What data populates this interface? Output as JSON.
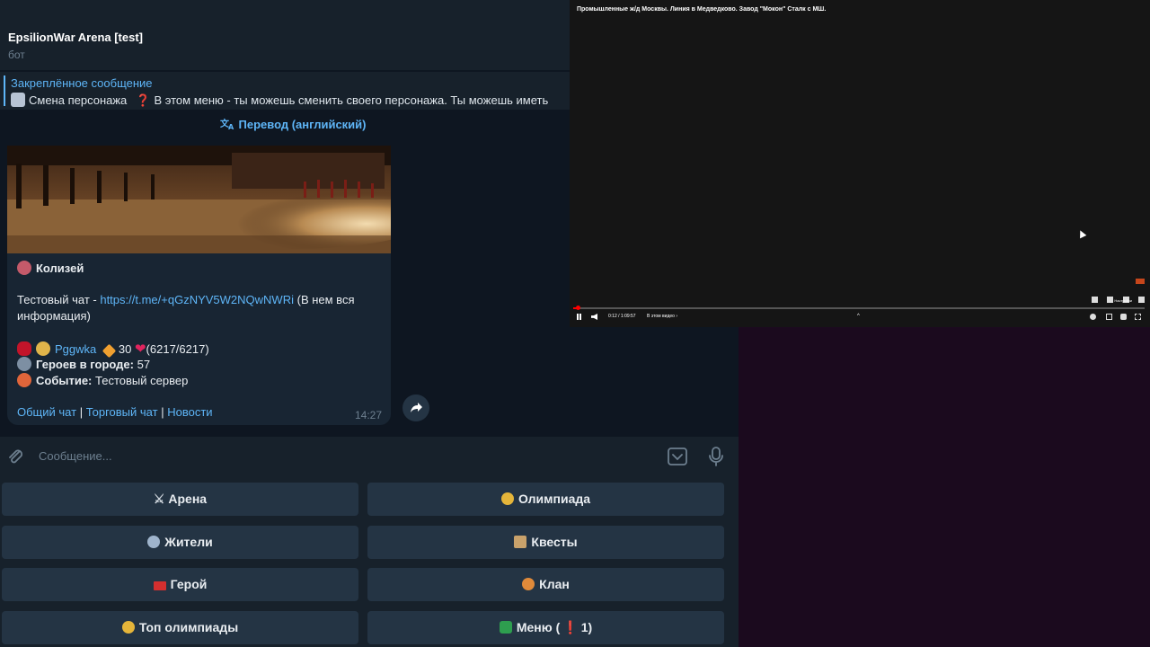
{
  "telegram": {
    "chat_title": "EpsilionWar Arena [test]",
    "chat_subtitle": "бот",
    "pinned": {
      "title": "Закреплённое сообщение",
      "lead": "Смена персонажа",
      "text": "В этом меню - ты можешь сменить своего персонажа. Ты можешь иметь"
    },
    "translate_label": "Перевод (английский)",
    "message": {
      "location": "Колизей",
      "test_chat_label": "Тестовый чат -",
      "test_chat_link": "https://t.me/+qGzNYV5W2NQwNWRi",
      "test_chat_note_1": "(В нем вся",
      "test_chat_note_2": "информация)",
      "player_name": "Pggwka",
      "player_level": "30",
      "player_hp": "(6217/6217)",
      "heroes_label": "Героев в городе:",
      "heroes_count": "57",
      "event_label": "Событие:",
      "event_value": "Тестовый сервер",
      "links": [
        "Общий чат",
        "Торговый чат",
        "Новости"
      ],
      "separator": "|",
      "time": "14:27"
    },
    "composer_placeholder": "Сообщение...",
    "keyboard": [
      {
        "label": "Арена",
        "icon": "crossed-swords-icon"
      },
      {
        "label": "Олимпиада",
        "icon": "medal-icon"
      },
      {
        "label": "Жители",
        "icon": "people-icon"
      },
      {
        "label": "Квесты",
        "icon": "scroll-icon"
      },
      {
        "label": "Герой",
        "icon": "flag-icon"
      },
      {
        "label": "Клан",
        "icon": "shield-icon"
      },
      {
        "label": "Топ олимпиады",
        "icon": "medal-icon"
      },
      {
        "label": "Меню (",
        "label_tail": "1)",
        "icon": "menu-icon"
      }
    ]
  },
  "video": {
    "title": "Промышленные ж/д Москвы. Линия в Медведково. Завод \"Мокон\" Сталк с МШ.",
    "time": "0:12 / 1:09:57",
    "chapter": "В этом видео",
    "settings_label": "Настройки"
  },
  "colors": {
    "tg_bg": "#0e1621",
    "tg_panel": "#17212b",
    "accent": "#5eb5f7",
    "button_bg": "#243444",
    "desktop_bg": "#1b0a1e"
  }
}
